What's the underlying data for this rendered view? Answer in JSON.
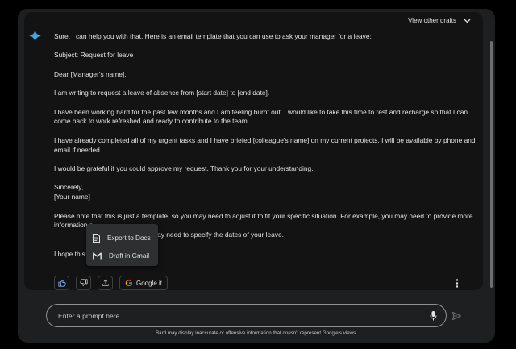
{
  "header": {
    "view_drafts_label": "View other drafts"
  },
  "response": {
    "paragraphs": [
      "Sure, I can help you with that. Here is an email template that you can use to ask your manager for a leave:",
      "Subject: Request for leave",
      "Dear [Manager's name],",
      "I am writing to request a leave of absence from [start date] to [end date].",
      "I have been working hard for the past few months and I am feeling burnt out. I would like to take this time to rest and recharge so that I can come back to work refreshed and ready to contribute to the team.",
      "I have already completed all of my urgent tasks and I have briefed [colleague's name] on my current projects. I will be available by phone and email if needed.",
      "I would be grateful if you could approve my request. Thank you for your understanding.",
      "Sincerely,",
      "[Your name]",
      "Please note that this is just a template, so you may need to adjust it to fit your specific situation. For example, you may need to provide more information a",
      "ting a leave, or you may need to specify the dates of your leave.",
      "I hope this he"
    ]
  },
  "actions": {
    "google_it_label": "Google it"
  },
  "share_menu": {
    "items": [
      {
        "label": "Export to Docs"
      },
      {
        "label": "Draft in Gmail"
      }
    ]
  },
  "prompt": {
    "placeholder": "Enter a prompt here",
    "value": ""
  },
  "footer": {
    "disclaimer": "Bard may display inaccurate or offensive information that doesn't represent Google's views."
  },
  "colors": {
    "background": "#1e1f20",
    "card": "#131314",
    "text": "#e3e3e3",
    "menu": "#2d2f31",
    "sparkle_blue": "#4285f4"
  },
  "icons": [
    "sparkle-icon",
    "chevron-down-icon",
    "thumbs-up-icon",
    "thumbs-down-icon",
    "share-icon",
    "google-icon",
    "more-vert-icon",
    "docs-icon",
    "gmail-icon",
    "mic-icon",
    "send-icon"
  ]
}
